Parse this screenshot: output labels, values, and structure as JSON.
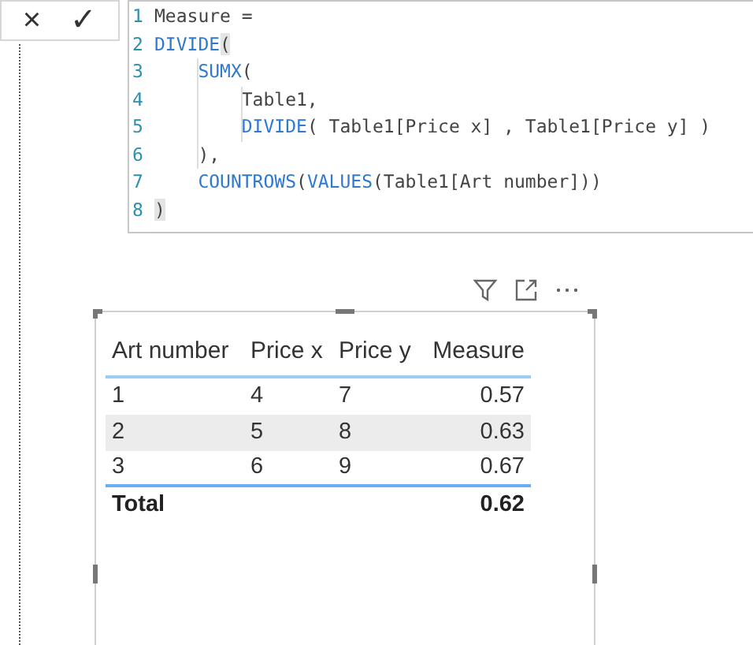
{
  "formula_bar": {
    "buttons": [
      "×",
      "✓"
    ],
    "lines": [
      {
        "number": "1",
        "tokens": [
          {
            "kind": "text",
            "text": "Measure ="
          }
        ]
      },
      {
        "number": "2",
        "tokens": [
          {
            "kind": "function",
            "text": "DIVIDE"
          },
          {
            "kind": "bracket",
            "text": "("
          }
        ]
      },
      {
        "number": "3",
        "tokens": [
          {
            "kind": "function",
            "text": "    SUMX"
          },
          {
            "kind": "text",
            "text": "("
          }
        ]
      },
      {
        "number": "4",
        "tokens": [
          {
            "kind": "text",
            "text": "        Table1,"
          }
        ]
      },
      {
        "number": "5",
        "tokens": [
          {
            "kind": "function",
            "text": "        DIVIDE"
          },
          {
            "kind": "text",
            "text": "( Table1[Price x] , Table1[Price y] )"
          }
        ]
      },
      {
        "number": "6",
        "tokens": [
          {
            "kind": "text",
            "text": "    ),"
          }
        ]
      },
      {
        "number": "7",
        "tokens": [
          {
            "kind": "function",
            "text": "    COUNTROWS"
          },
          {
            "kind": "text",
            "text": "("
          },
          {
            "kind": "function",
            "text": "VALUES"
          },
          {
            "kind": "text",
            "text": "(Table1[Art number]))"
          }
        ]
      },
      {
        "number": "8",
        "tokens": [
          {
            "kind": "bracket",
            "text": ")"
          }
        ]
      }
    ]
  },
  "visual": {
    "header_icons": [
      {
        "kind": "filter"
      },
      {
        "kind": "focus"
      },
      {
        "kind": "more"
      }
    ],
    "table": {
      "columns": [
        "Art number",
        "Price x",
        "Price y",
        "Measure"
      ],
      "rows": [
        [
          "1",
          "4",
          "7",
          "0.57"
        ],
        [
          "2",
          "5",
          "8",
          "0.63"
        ],
        [
          "3",
          "6",
          "9",
          "0.67"
        ]
      ],
      "total": {
        "label": "Total",
        "value": "0.62"
      }
    }
  }
}
